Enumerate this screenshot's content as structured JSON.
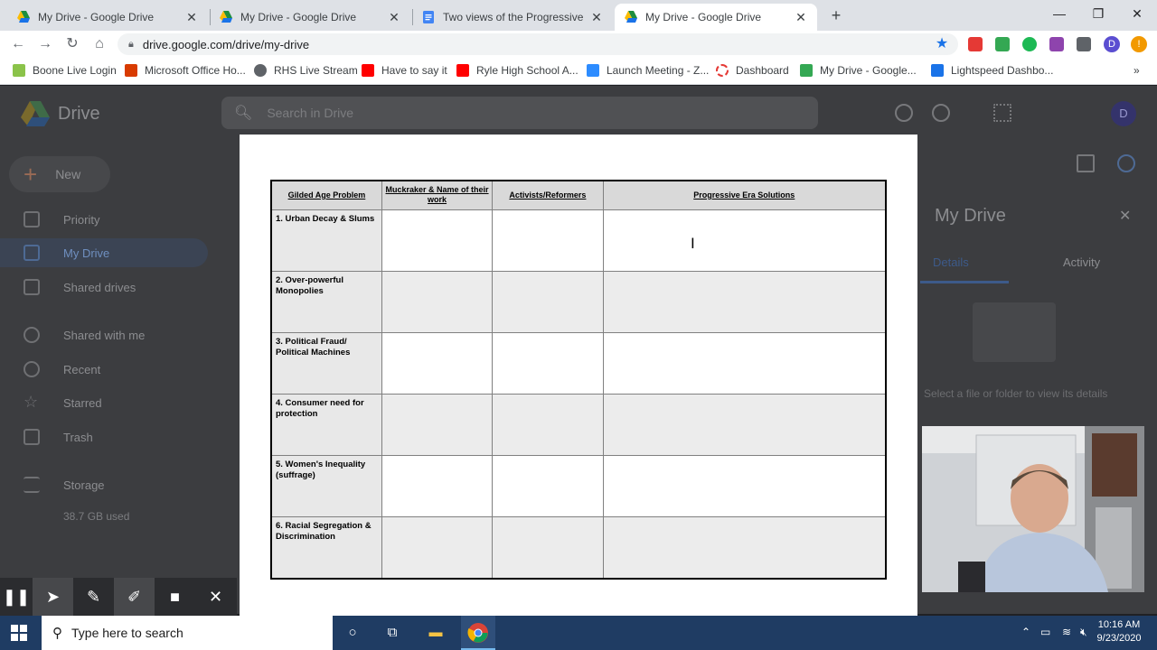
{
  "browser": {
    "tabs": [
      {
        "title": "My Drive - Google Drive",
        "active": false
      },
      {
        "title": "My Drive - Google Drive",
        "active": false
      },
      {
        "title": "Two views of the Progressive Era",
        "active": false
      },
      {
        "title": "My Drive - Google Drive",
        "active": true
      }
    ],
    "new_tab_symbol": "+",
    "url": "drive.google.com/drive/my-drive",
    "profile_initial": "D",
    "bookmarks": [
      "Boone Live Login",
      "Microsoft Office Ho...",
      "RHS Live Stream",
      "Have to say it",
      "Ryle High School A...",
      "Launch Meeting - Z...",
      "Dashboard",
      "My Drive - Google...",
      "Lightspeed Dashbo..."
    ],
    "more_bookmarks_symbol": "»"
  },
  "drive": {
    "app_title": "Drive",
    "search_placeholder": "Search in Drive",
    "avatar_initial": "D",
    "new_label": "New",
    "sidebar": [
      {
        "label": "Priority"
      },
      {
        "label": "My Drive",
        "selected": true
      },
      {
        "label": "Shared drives"
      },
      {
        "label": "Shared with me"
      },
      {
        "label": "Recent"
      },
      {
        "label": "Starred"
      },
      {
        "label": "Trash"
      },
      {
        "label": "Storage"
      }
    ],
    "storage_used": "38.7 GB used",
    "details": {
      "title": "My Drive",
      "tab_details": "Details",
      "tab_activity": "Activity",
      "hint": "Select a file or folder to view its details"
    }
  },
  "worksheet": {
    "headers": [
      "Gilded Age Problem",
      "Muckraker & Name of their work",
      "Activists/Reformers",
      "Progressive Era Solutions"
    ],
    "rows": [
      "1. Urban Decay & Slums",
      "2. Over-powerful Monopolies",
      "3. Political Fraud/ Political Machines",
      "4. Consumer need for protection",
      "5. Women's Inequality (suffrage)",
      "6. Racial Segregation & Discrimination"
    ]
  },
  "cursor_glyph": "I",
  "taskbar": {
    "search_placeholder": "Type here to search",
    "time": "10:16 AM",
    "date": "9/23/2020"
  },
  "colors": {
    "drive_blue": "#1a73e8",
    "taskbar": "#1f3c63",
    "tab_strip": "#dee1e6"
  }
}
